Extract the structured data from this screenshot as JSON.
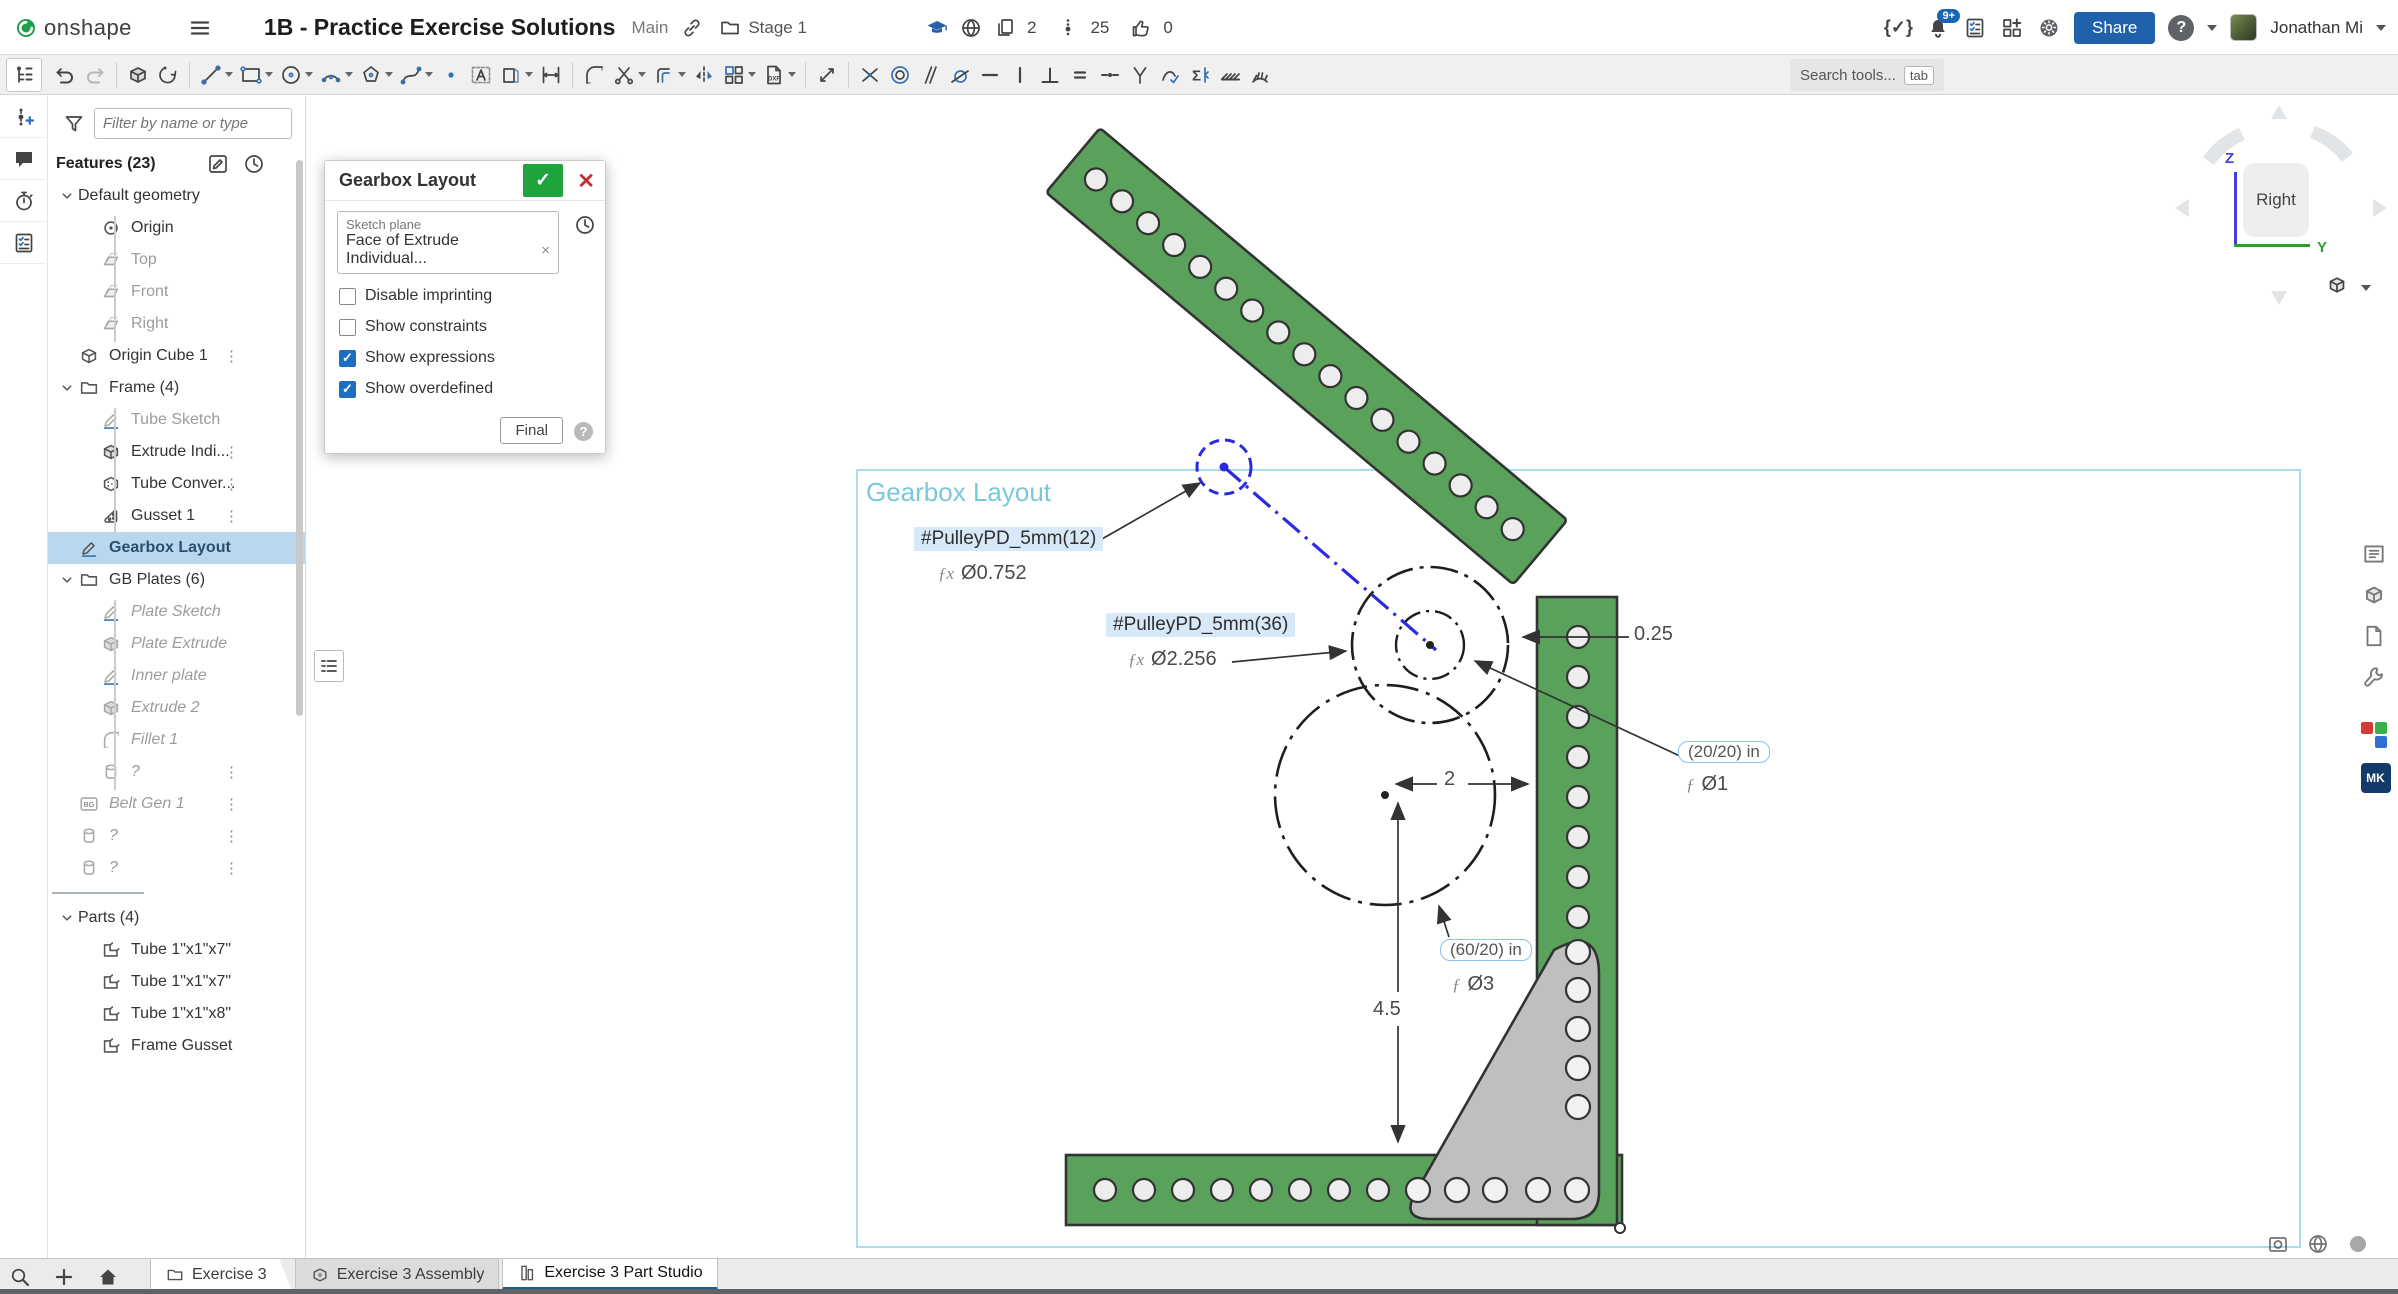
{
  "header": {
    "logo_text": "onshape",
    "title": "1B - Practice Exercise Solutions",
    "workspace": "Main",
    "version_label": "Stage 1",
    "stat_copies": "2",
    "stat_versions": "25",
    "stat_likes": "0",
    "notification_badge": "9+",
    "share_label": "Share",
    "help_label": "?",
    "user_name": "Jonathan Mi"
  },
  "toolbar": {
    "search_placeholder": "Search tools...",
    "search_kbd": "tab",
    "tools": [
      {
        "name": "undo",
        "icon": "undo"
      },
      {
        "name": "redo",
        "icon": "redo",
        "dim": true
      },
      {
        "name": "sep"
      },
      {
        "name": "extrude-tool",
        "icon": "extrude3d"
      },
      {
        "name": "revolve-tool",
        "icon": "revolve"
      },
      {
        "name": "sep"
      },
      {
        "name": "sketch-line",
        "icon": "line",
        "caret": true
      },
      {
        "name": "sketch-rectangle",
        "icon": "rect",
        "caret": true
      },
      {
        "name": "sketch-circle",
        "icon": "circleT",
        "caret": true
      },
      {
        "name": "sketch-arc",
        "icon": "arc",
        "caret": true
      },
      {
        "name": "sketch-polygon",
        "icon": "polygon",
        "caret": true
      },
      {
        "name": "sketch-spline",
        "icon": "spline",
        "caret": true
      },
      {
        "name": "sketch-point",
        "icon": "point"
      },
      {
        "name": "sketch-text",
        "icon": "textT"
      },
      {
        "name": "sketch-use",
        "icon": "use",
        "caret": true
      },
      {
        "name": "sketch-dimension",
        "icon": "dimension"
      },
      {
        "name": "sep"
      },
      {
        "name": "fillet-tool",
        "icon": "fillet"
      },
      {
        "name": "trim-tool",
        "icon": "trim",
        "caret": true
      },
      {
        "name": "offset-tool",
        "icon": "offset",
        "caret": true
      },
      {
        "name": "mirror-tool",
        "icon": "mirror"
      },
      {
        "name": "pattern-tool",
        "icon": "pattern",
        "caret": true
      },
      {
        "name": "import-dxf-tool",
        "icon": "dxf",
        "caret": true
      },
      {
        "name": "sep"
      },
      {
        "name": "transform-tool",
        "icon": "transform"
      },
      {
        "name": "sep"
      },
      {
        "name": "constraint-coincident",
        "icon": "coincident"
      },
      {
        "name": "constraint-concentric",
        "icon": "concentric"
      },
      {
        "name": "constraint-parallel",
        "icon": "parallel"
      },
      {
        "name": "constraint-tangent",
        "icon": "tangent"
      },
      {
        "name": "constraint-horizontal",
        "icon": "horizontal"
      },
      {
        "name": "constraint-vertical",
        "icon": "vertical"
      },
      {
        "name": "constraint-perpendicular",
        "icon": "perpendicular"
      },
      {
        "name": "constraint-equal",
        "icon": "equal"
      },
      {
        "name": "constraint-midpoint",
        "icon": "midpoint"
      },
      {
        "name": "constraint-symmetric",
        "icon": "symmetric"
      },
      {
        "name": "constraint-curvature",
        "icon": "curvature"
      },
      {
        "name": "constraint-pierce",
        "icon": "sigma"
      },
      {
        "name": "constraint-fix",
        "icon": "hatch"
      },
      {
        "name": "constraint-normal",
        "icon": "normal"
      }
    ]
  },
  "left_rail": {
    "items": [
      {
        "name": "versions",
        "icon": "versions"
      },
      {
        "name": "comments",
        "icon": "comment"
      },
      {
        "name": "history",
        "icon": "stopwatch"
      },
      {
        "name": "checklist",
        "icon": "checklist"
      }
    ]
  },
  "features_panel": {
    "filter_placeholder": "Filter by name or type",
    "header": "Features (23)",
    "tree": [
      {
        "label": "Default geometry",
        "chevron": true,
        "indent": 0
      },
      {
        "label": "Origin",
        "icon": "origin",
        "indent": 1
      },
      {
        "label": "Top",
        "icon": "plane",
        "indent": 1,
        "muted": true
      },
      {
        "label": "Front",
        "icon": "plane",
        "indent": 1,
        "muted": true
      },
      {
        "label": "Right",
        "icon": "plane",
        "indent": 1,
        "muted": true
      },
      {
        "label": "Origin Cube 1",
        "icon": "cube",
        "indent": 0,
        "dots": true
      },
      {
        "label": "Frame (4)",
        "chevron": true,
        "icon": "folder",
        "indent": 0
      },
      {
        "label": "Tube Sketch",
        "icon": "sketch",
        "indent": 1,
        "muted": true
      },
      {
        "label": "Extrude Indi...",
        "icon": "extrudeS",
        "indent": 1,
        "dots": true
      },
      {
        "label": "Tube Conver...",
        "icon": "convert",
        "indent": 1,
        "dots": true
      },
      {
        "label": "Gusset 1",
        "icon": "gusset",
        "indent": 1,
        "dots": true
      },
      {
        "label": "Gearbox Layout",
        "icon": "sketch",
        "indent": 0,
        "selected": true
      },
      {
        "label": "GB Plates (6)",
        "chevron": true,
        "icon": "folder",
        "indent": 0
      },
      {
        "label": "Plate Sketch",
        "icon": "sketch",
        "indent": 1,
        "muted": true,
        "italic": true
      },
      {
        "label": "Plate Extrude",
        "icon": "extrudeS",
        "indent": 1,
        "muted": true,
        "italic": true
      },
      {
        "label": "Inner plate",
        "icon": "sketch",
        "indent": 1,
        "muted": true,
        "italic": true
      },
      {
        "label": "Extrude 2",
        "icon": "extrudeS",
        "indent": 1,
        "muted": true,
        "italic": true
      },
      {
        "label": "Fillet 1",
        "icon": "fillet",
        "indent": 1,
        "muted": true,
        "italic": true
      },
      {
        "label": "?",
        "icon": "cylinder",
        "indent": 1,
        "muted": true,
        "italic": true,
        "dots": true
      },
      {
        "label": "Belt Gen 1",
        "icon": "bgBadge",
        "indent": 0,
        "muted": true,
        "italic": true,
        "dots": true
      },
      {
        "label": "?",
        "icon": "cylinder",
        "indent": 0,
        "muted": true,
        "italic": true,
        "dots": true
      },
      {
        "label": "?",
        "icon": "cylinder",
        "indent": 0,
        "muted": true,
        "italic": true,
        "dots": true
      },
      {
        "rollback": true
      },
      {
        "label": "Parts (4)",
        "chevron": true,
        "indent": 0
      },
      {
        "label": "Tube 1\"x1\"x7\"",
        "icon": "part",
        "indent": 1
      },
      {
        "label": "Tube 1\"x1\"x7\"",
        "icon": "part",
        "indent": 1
      },
      {
        "label": "Tube 1\"x1\"x8\"",
        "icon": "part",
        "indent": 1
      },
      {
        "label": "Frame Gusset",
        "icon": "part",
        "indent": 1
      }
    ]
  },
  "dialog": {
    "title": "Gearbox Layout",
    "confirm_glyph": "✓",
    "close_glyph": "✕",
    "sketch_plane_label": "Sketch plane",
    "sketch_plane_value": "Face of Extrude Individual...",
    "remove_glyph": "×",
    "checkboxes": [
      {
        "label": "Disable imprinting",
        "checked": false
      },
      {
        "label": "Show constraints",
        "checked": false
      },
      {
        "label": "Show expressions",
        "checked": true
      },
      {
        "label": "Show overdefined",
        "checked": true
      }
    ],
    "final_label": "Final",
    "help_glyph": "?"
  },
  "canvas": {
    "sketch_label": "Gearbox Layout",
    "annotations": {
      "pulley12_label": "#PulleyPD_5mm(12)",
      "pulley12_value": "Ø0.752",
      "pulley36_label": "#PulleyPD_5mm(36)",
      "pulley36_value": "Ø2.256",
      "fx_symbol": "ƒx",
      "f_symbol": "ƒ",
      "dim_offset": "0.25",
      "ratio_badge_1": "(20/20) in",
      "dia_1": "Ø1",
      "dim_center": "2",
      "ratio_badge_2": "(60/20) in",
      "dia_3": "Ø3",
      "dim_height": "4.5"
    },
    "app_rail": [
      {
        "name": "insert-panel",
        "icon": "bom"
      },
      {
        "name": "parts-panel",
        "icon": "cubeSmall"
      },
      {
        "name": "docs-panel",
        "icon": "doc"
      },
      {
        "name": "config-panel",
        "icon": "wrench"
      }
    ],
    "mk_label": "MK"
  },
  "view_cube": {
    "face": "Right",
    "axis_z": "Z",
    "axis_y": "Y"
  },
  "bottom_bar": {
    "tabs": [
      {
        "label": "Exercise 3",
        "icon": "folder",
        "style": "first"
      },
      {
        "label": "Exercise 3 Assembly",
        "icon": "assembly",
        "style": ""
      },
      {
        "label": "Exercise 3 Part Studio",
        "icon": "partstudio",
        "style": "active"
      }
    ]
  }
}
